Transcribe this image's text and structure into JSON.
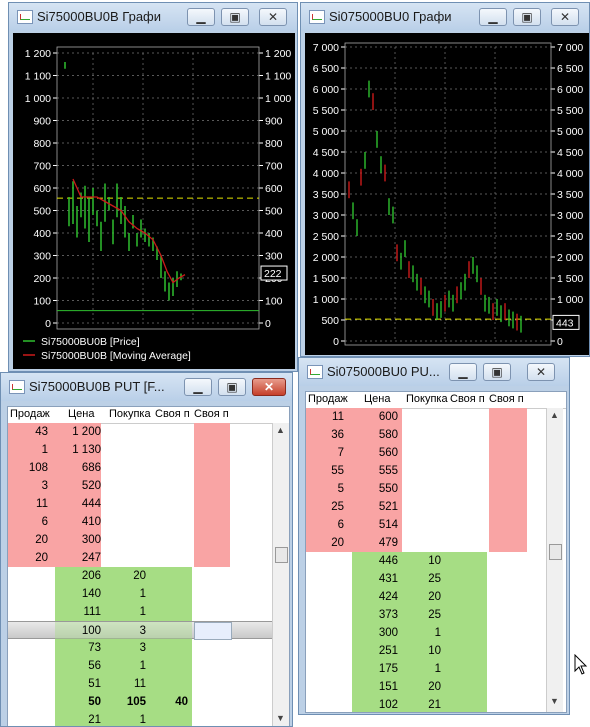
{
  "windows": {
    "chart1": {
      "title": "Si75000BU0B Графи",
      "price_tag": "222",
      "legend": [
        {
          "label": "Si75000BU0B [Price]",
          "color": "#2fbf2f"
        },
        {
          "label": "Si75000BU0B [Moving Average]",
          "color": "#cc1a1a"
        }
      ],
      "left_axis": [
        "1 200",
        "1 100",
        "1 000",
        "900",
        "800",
        "700",
        "600",
        "500",
        "400",
        "300",
        "200",
        "100",
        "0"
      ],
      "right_axis": [
        "1 200",
        "1 100",
        "1 000",
        "900",
        "800",
        "700",
        "600",
        "500",
        "400",
        "300",
        "200",
        "100",
        "0"
      ]
    },
    "chart2": {
      "title": "Si075000BU0 Графи",
      "price_tag": "443",
      "axis": [
        "7 000",
        "6 500",
        "6 000",
        "5 500",
        "5 000",
        "4 500",
        "4 000",
        "3 500",
        "3 000",
        "2 500",
        "2 000",
        "1 500",
        "1 000",
        "500",
        "0"
      ]
    },
    "book1": {
      "title": "Si75000BU0B PUT [F...",
      "headers": [
        "Продаж",
        "Цена",
        "Покупка",
        "Своя п",
        "Своя п"
      ],
      "sells": [
        {
          "qty": "43",
          "price": "1 200"
        },
        {
          "qty": "1",
          "price": "1 130"
        },
        {
          "qty": "108",
          "price": "686"
        },
        {
          "qty": "3",
          "price": "520"
        },
        {
          "qty": "11",
          "price": "444"
        },
        {
          "qty": "6",
          "price": "410"
        },
        {
          "qty": "20",
          "price": "300"
        },
        {
          "qty": "20",
          "price": "247"
        }
      ],
      "buys": [
        {
          "price": "206",
          "qty": "20",
          "own": "",
          "bold": false
        },
        {
          "price": "140",
          "qty": "1",
          "own": "",
          "bold": false
        },
        {
          "price": "111",
          "qty": "1",
          "own": "",
          "bold": false
        },
        {
          "price": "100",
          "qty": "3",
          "own": "",
          "bold": false,
          "selected": true
        },
        {
          "price": "73",
          "qty": "3",
          "own": "",
          "bold": false
        },
        {
          "price": "56",
          "qty": "1",
          "own": "",
          "bold": false
        },
        {
          "price": "51",
          "qty": "11",
          "own": "",
          "bold": false
        },
        {
          "price": "50",
          "qty": "105",
          "own": "40",
          "bold": true
        },
        {
          "price": "21",
          "qty": "1",
          "own": "",
          "bold": false
        }
      ]
    },
    "book2": {
      "title": "Si075000BU0 PU...",
      "headers": [
        "Продаж",
        "Цена",
        "Покупка",
        "Своя п",
        "Своя п"
      ],
      "sells": [
        {
          "qty": "11",
          "price": "600"
        },
        {
          "qty": "36",
          "price": "580"
        },
        {
          "qty": "7",
          "price": "560"
        },
        {
          "qty": "55",
          "price": "555"
        },
        {
          "qty": "5",
          "price": "550"
        },
        {
          "qty": "25",
          "price": "521"
        },
        {
          "qty": "6",
          "price": "514"
        },
        {
          "qty": "20",
          "price": "479"
        }
      ],
      "buys": [
        {
          "price": "446",
          "qty": "10"
        },
        {
          "price": "431",
          "qty": "25"
        },
        {
          "price": "424",
          "qty": "20"
        },
        {
          "price": "373",
          "qty": "25"
        },
        {
          "price": "300",
          "qty": "1"
        },
        {
          "price": "251",
          "qty": "10"
        },
        {
          "price": "175",
          "qty": "1"
        },
        {
          "price": "151",
          "qty": "20"
        },
        {
          "price": "102",
          "qty": "21"
        }
      ]
    }
  },
  "colors": {
    "sell": "#f9a4a4",
    "buy": "#a6dd84",
    "price": "#2fbf2f",
    "ma": "#cc1a1a",
    "level": "#e6e600"
  }
}
